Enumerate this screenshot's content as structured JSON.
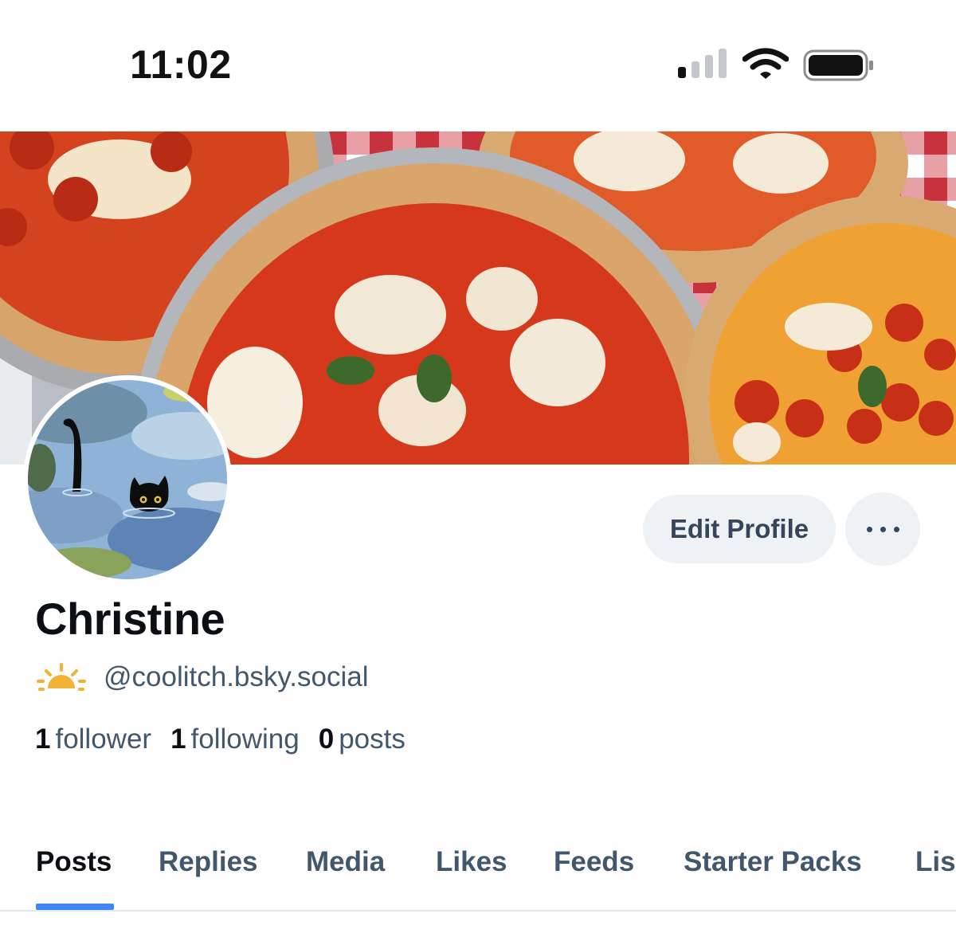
{
  "status_bar": {
    "time": "11:02"
  },
  "profile": {
    "display_name": "Christine",
    "handle": "@coolitch.bsky.social",
    "stats": {
      "followers_count": "1",
      "followers_label": "follower",
      "following_count": "1",
      "following_label": "following",
      "posts_count": "0",
      "posts_label": "posts"
    }
  },
  "actions": {
    "edit_profile_label": "Edit Profile"
  },
  "tabs": [
    {
      "label": "Posts",
      "active": true
    },
    {
      "label": "Replies"
    },
    {
      "label": "Media"
    },
    {
      "label": "Likes"
    },
    {
      "label": "Feeds"
    },
    {
      "label": "Starter Packs"
    },
    {
      "label": "Lists"
    }
  ],
  "icons": {
    "signal": "cellular-signal-icon",
    "wifi": "wifi-icon",
    "battery": "battery-icon",
    "more": "more-options-icon",
    "sun": "sun-icon"
  },
  "colors": {
    "accent": "#3f87f5",
    "button_bg": "#eff2f5",
    "muted_text": "#42576c",
    "primary_text": "#0b0f14"
  }
}
